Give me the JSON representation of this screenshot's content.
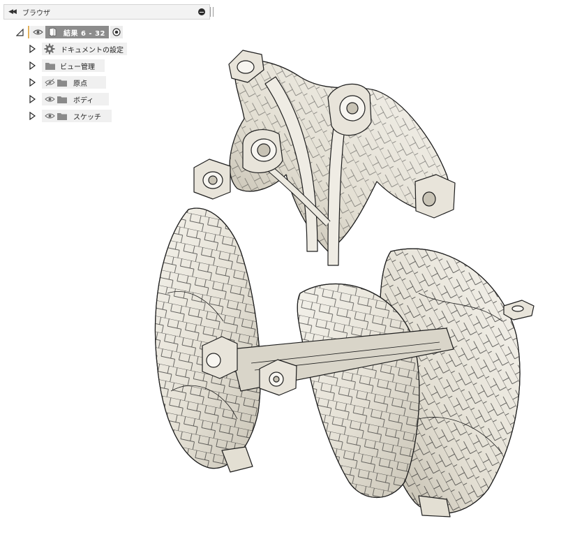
{
  "browser": {
    "title": "ブラウザ",
    "root": {
      "label": "結果 6 - 32"
    },
    "items": [
      {
        "label": "ドキュメントの設定",
        "icon": "gear-icon"
      },
      {
        "label": "ビュー管理",
        "icon": "folder-icon"
      },
      {
        "label": "原点",
        "icon": "folder-icon",
        "visibility": "hidden"
      },
      {
        "label": "ボディ",
        "icon": "folder-icon",
        "visibility": "visible"
      },
      {
        "label": "スケッチ",
        "icon": "folder-icon",
        "visibility": "visible"
      }
    ]
  },
  "viewport": {
    "content": "generative-design-part-model",
    "colors": {
      "surface": "#ece9e0",
      "shade": "#c9c4b6",
      "edge": "#1e1e1e"
    }
  }
}
